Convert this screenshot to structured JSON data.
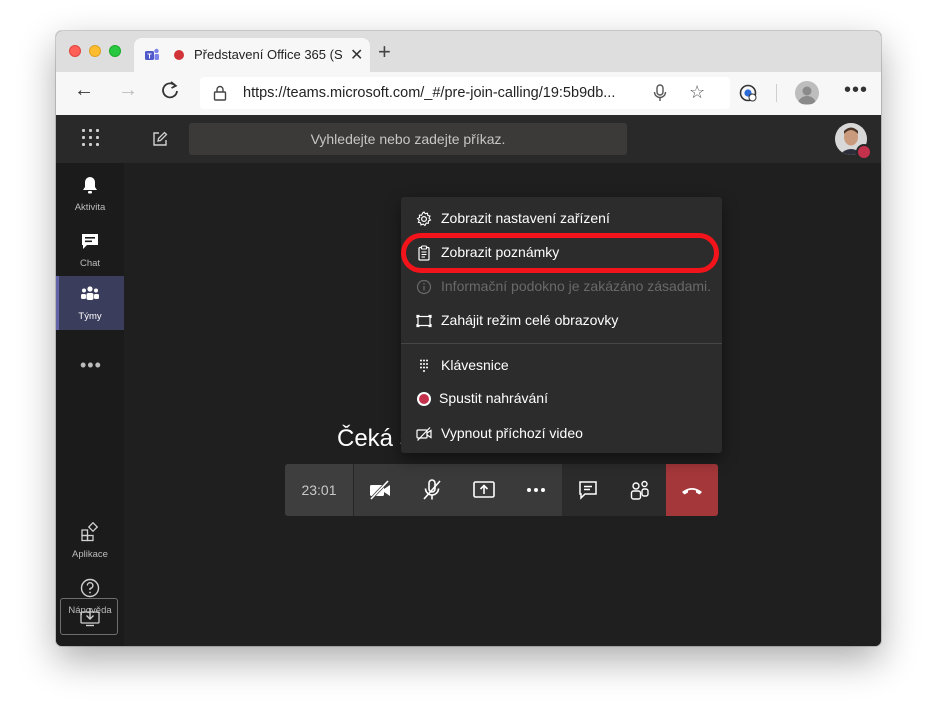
{
  "browser": {
    "tab_title": "Představení Office 365 (S",
    "url": "https://teams.microsoft.com/_#/pre-join-calling/19:5b9db..."
  },
  "teams": {
    "search_placeholder": "Vyhledejte nebo zadejte příkaz.",
    "rail": {
      "activity": "Aktivita",
      "chat": "Chat",
      "teams": "Týmy",
      "apps": "Aplikace",
      "help": "Nápověda"
    }
  },
  "call": {
    "waiting_text": "Čeká s",
    "timer": "23:01"
  },
  "menu": {
    "items": [
      {
        "label": "Zobrazit nastavení zařízení"
      },
      {
        "label": "Zobrazit poznámky"
      },
      {
        "label": "Informační podokno je zakázáno zásadami."
      },
      {
        "label": "Zahájit režim celé obrazovky"
      },
      {
        "label": "Klávesnice"
      },
      {
        "label": "Spustit nahrávání"
      },
      {
        "label": "Vypnout příchozí video"
      }
    ]
  },
  "colors": {
    "accent": "#6264a7",
    "hangup": "#a4373a",
    "highlight": "#f2141a",
    "record": "#c4314b"
  }
}
